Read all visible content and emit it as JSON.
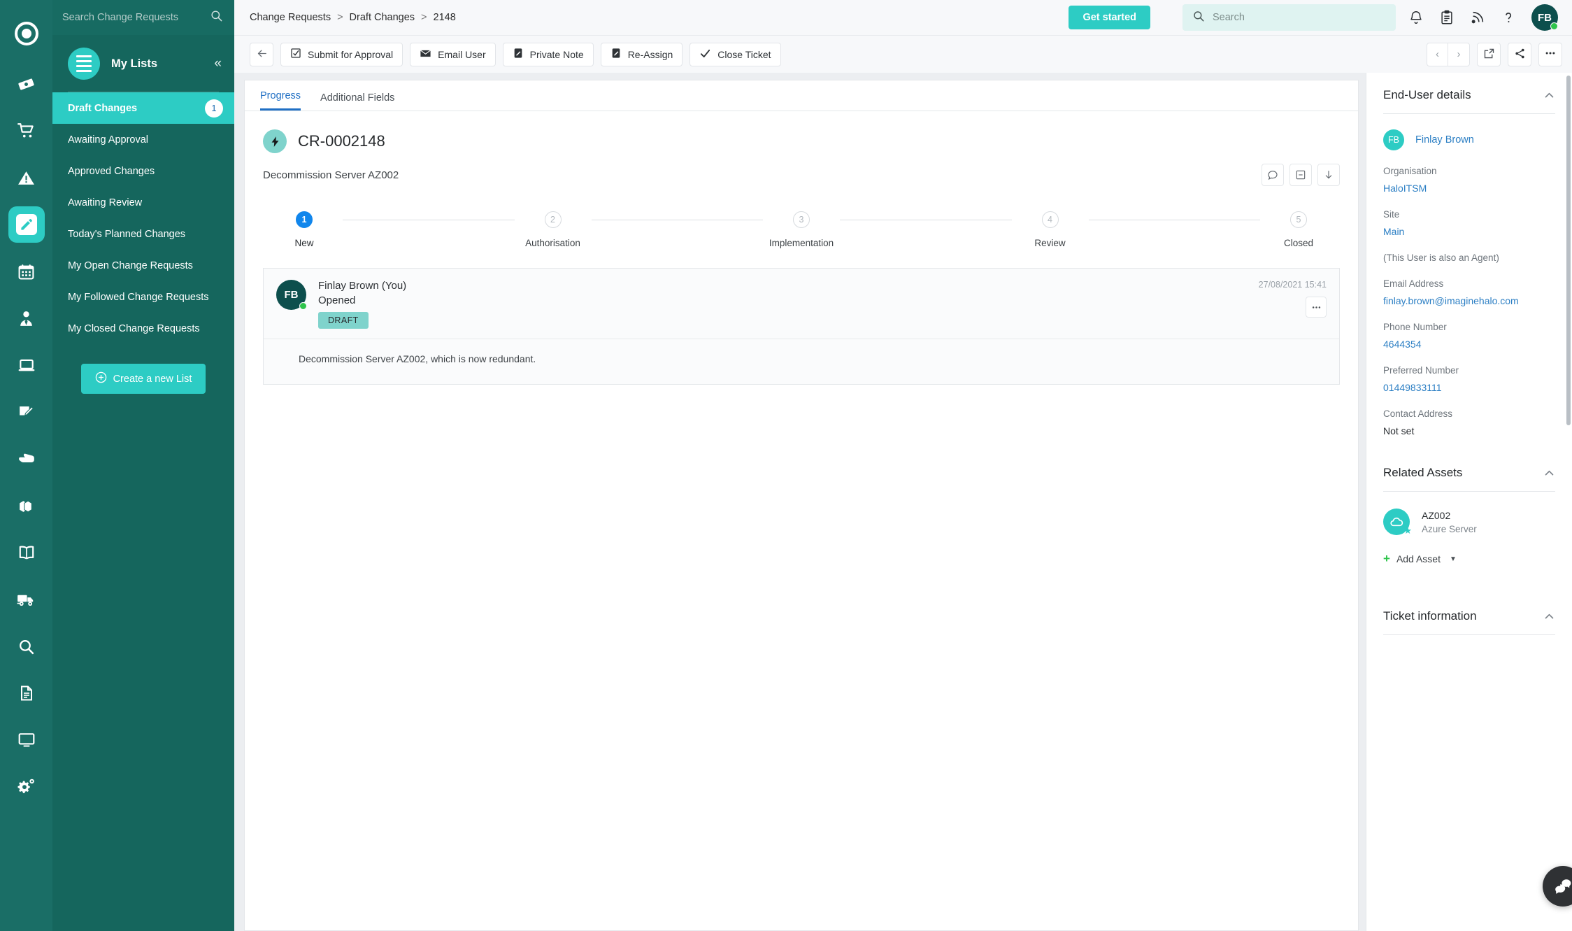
{
  "rail": {
    "logo_icon": "halo-ring-logo",
    "items": [
      {
        "icon": "ticket-icon",
        "name": "tickets"
      },
      {
        "icon": "shopping-cart-icon",
        "name": "requests"
      },
      {
        "icon": "warning-triangle-icon",
        "name": "incidents"
      },
      {
        "icon": "pencil-square-icon",
        "name": "change-requests",
        "active": true
      },
      {
        "icon": "calendar-icon",
        "name": "calendar"
      },
      {
        "icon": "user-tie-icon",
        "name": "users"
      },
      {
        "icon": "laptop-icon",
        "name": "assets"
      },
      {
        "icon": "edit-document-icon",
        "name": "contracts"
      },
      {
        "icon": "hand-point-icon",
        "name": "approvals"
      },
      {
        "icon": "boxes-icon",
        "name": "products"
      },
      {
        "icon": "book-open-icon",
        "name": "knowledge-base"
      },
      {
        "icon": "truck-icon",
        "name": "suppliers"
      },
      {
        "icon": "magnifier-icon",
        "name": "search"
      },
      {
        "icon": "file-lines-icon",
        "name": "reports"
      },
      {
        "icon": "monitor-icon",
        "name": "dashboards"
      },
      {
        "icon": "gears-icon",
        "name": "settings"
      }
    ]
  },
  "listpanel": {
    "search_placeholder": "Search Change Requests",
    "search_value": "",
    "search_icon": "magnifier-icon",
    "title": "My Lists",
    "burger_icon": "hamburger-icon",
    "collapse_icon": "double-chevron-left-icon",
    "items": [
      {
        "label": "Draft Changes",
        "badge": "1",
        "active": true
      },
      {
        "label": "Awaiting Approval",
        "badge": "",
        "active": false
      },
      {
        "label": "Approved Changes",
        "badge": "",
        "active": false
      },
      {
        "label": "Awaiting Review",
        "badge": "",
        "active": false
      },
      {
        "label": "Today's Planned Changes",
        "badge": "",
        "active": false
      },
      {
        "label": "My Open Change Requests",
        "badge": "",
        "active": false
      },
      {
        "label": "My Followed Change Requests",
        "badge": "",
        "active": false
      },
      {
        "label": "My Closed Change Requests",
        "badge": "",
        "active": false
      }
    ],
    "create_list_label": "Create a new List",
    "create_list_icon": "plus-circle-icon"
  },
  "topbar": {
    "breadcrumb": [
      "Change Requests",
      "Draft Changes",
      "2148"
    ],
    "separator": ">",
    "get_started_label": "Get started",
    "search_placeholder": "Search",
    "search_value": "",
    "search_icon": "magnifier-icon",
    "icons": [
      {
        "name": "bell-icon"
      },
      {
        "name": "clipboard-icon"
      },
      {
        "name": "rss-feed-icon"
      },
      {
        "name": "question-mark-icon"
      }
    ],
    "avatar_initials": "FB"
  },
  "actionbar": {
    "back_icon": "arrow-left-icon",
    "buttons": [
      {
        "label": "Submit for Approval",
        "icon": "checkbox-checked-icon"
      },
      {
        "label": "Email User",
        "icon": "envelope-icon"
      },
      {
        "label": "Private Note",
        "icon": "pencil-note-icon"
      },
      {
        "label": "Re-Assign",
        "icon": "pencil-note-icon"
      },
      {
        "label": "Close Ticket",
        "icon": "check-icon"
      }
    ],
    "prev_icon": "chevron-left-icon",
    "next_icon": "chevron-right-icon",
    "popout_icon": "external-link-icon",
    "share_icon": "share-nodes-icon",
    "more_icon": "ellipsis-icon"
  },
  "main": {
    "tabs": [
      {
        "label": "Progress",
        "active": true
      },
      {
        "label": "Additional Fields",
        "active": false
      }
    ],
    "ticket_id": "CR-0002148",
    "ticket_icon": "lightning-bolt-icon",
    "ticket_summary": "Decommission Server AZ002",
    "header_icons": [
      {
        "name": "comment-bubble-icon"
      },
      {
        "name": "minus-box-icon"
      },
      {
        "name": "arrow-down-icon"
      }
    ],
    "steps": [
      {
        "num": "1",
        "label": "New",
        "done": true
      },
      {
        "num": "2",
        "label": "Authorisation",
        "done": false
      },
      {
        "num": "3",
        "label": "Implementation",
        "done": false
      },
      {
        "num": "4",
        "label": "Review",
        "done": false
      },
      {
        "num": "5",
        "label": "Closed",
        "done": false
      }
    ],
    "note": {
      "avatar_initials": "FB",
      "author": "Finlay Brown (You)",
      "action": "Opened",
      "tag": "DRAFT",
      "timestamp": "27/08/2021 15:41",
      "kebab_icon": "ellipsis-icon",
      "body": "Decommission Server AZ002, which is now redundant."
    }
  },
  "rightbar": {
    "enduser": {
      "title": "End-User details",
      "collapse_icon": "chevron-up-icon",
      "avatar_initials": "FB",
      "name": "Finlay Brown",
      "organisation_label": "Organisation",
      "organisation_value": "HaloITSM",
      "site_label": "Site",
      "site_value": "Main",
      "agent_note": "(This User is also an Agent)",
      "email_label": "Email Address",
      "email_value": "finlay.brown@imaginehalo.com",
      "phone_label": "Phone Number",
      "phone_value": "4644354",
      "preferred_label": "Preferred Number",
      "preferred_value": "01449833111",
      "address_label": "Contact Address",
      "address_value": "Not set"
    },
    "assets": {
      "title": "Related Assets",
      "collapse_icon": "chevron-up-icon",
      "items": [
        {
          "name": "AZ002",
          "type": "Azure Server",
          "icon": "cloud-icon"
        }
      ],
      "add_label": "Add Asset",
      "add_icon": "plus-icon",
      "caret_icon": "caret-down-icon"
    },
    "ticketinfo": {
      "title": "Ticket information",
      "collapse_icon": "chevron-up-icon"
    },
    "chat_icon": "chat-bubbles-icon"
  },
  "colors": {
    "brand_teal": "#2dccc4",
    "sidebar_dark": "#176b62",
    "rail_dark": "#1a6e66",
    "link_blue": "#2c7fc4",
    "step_active_blue": "#1186ec",
    "tab_active_blue": "#1f6fc4",
    "status_green": "#2ec44b",
    "avatar_dark": "#0d4f4d",
    "draft_tag": "#7fd3cc"
  }
}
